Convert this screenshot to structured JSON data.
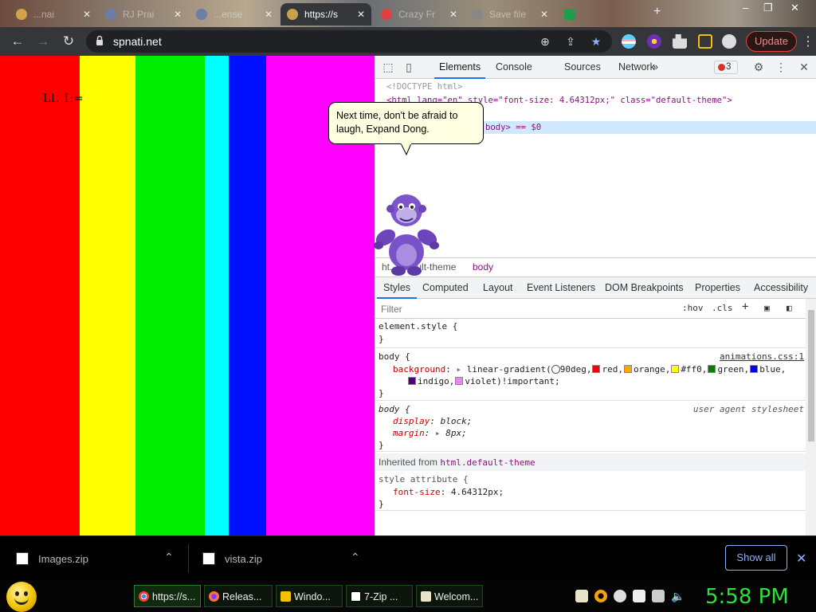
{
  "tabs": [
    {
      "title": "...nai"
    },
    {
      "title": "RJ Prai"
    },
    {
      "title": "...ense"
    },
    {
      "title": "https://s"
    },
    {
      "title": "Crazy Fr"
    },
    {
      "title": "Save file"
    }
  ],
  "new_tab_label": "+",
  "toolbar": {
    "url": "spnati.net",
    "update_label": "Update"
  },
  "page": {
    "body_text": "Ll. I:=",
    "stripe_colors": [
      "#ff0000",
      "#ffff00",
      "#00ee00",
      "#00ffff",
      "#0010ff",
      "#ff00ff"
    ]
  },
  "bonzi": {
    "speech": "Next time, don't be afraid to laugh, Expand Dong."
  },
  "devtools": {
    "tabs": [
      "Elements",
      "Console",
      "Sources",
      "Network"
    ],
    "more": "»",
    "error_count": "3",
    "dom": {
      "doctype": "<!DOCTYPE html>",
      "html_line": "<html lang=\"en\" style=\"font-size: 4.64312px;\" class=\"default-theme\">",
      "selected_line": "body> == $0"
    },
    "breadcrumbs": [
      "ht...default-theme",
      "body"
    ],
    "subtabs": [
      "Styles",
      "Computed",
      "Layout",
      "Event Listeners",
      "DOM Breakpoints",
      "Properties",
      "Accessibility"
    ],
    "filter_placeholder": "Filter",
    "hov": ":hov",
    "cls": ".cls",
    "rules": {
      "element_style": "element.style {",
      "close": "}",
      "body_selector": "body {",
      "body_source": "animations.css:1",
      "background_prop": "background",
      "gradient_prefix": "linear-gradient(",
      "gradient_angle": "90deg,",
      "gradient_colors": [
        {
          "name": "red,",
          "swatch": "#ff0000"
        },
        {
          "name": "orange,",
          "swatch": "#ffa500"
        },
        {
          "name": "#ff0,",
          "swatch": "#ffff00"
        },
        {
          "name": "green,",
          "swatch": "#008000"
        },
        {
          "name": "blue,",
          "swatch": "#0000ff"
        }
      ],
      "gradient_colors_2": [
        {
          "name": "indigo,",
          "swatch": "#4b0082"
        },
        {
          "name": "violet)!important;",
          "swatch": "#ee82ee"
        }
      ],
      "ua_selector": "body {",
      "ua_source": "user agent stylesheet",
      "display_prop": "display",
      "display_val": "block;",
      "margin_prop": "margin",
      "margin_val": "8px;",
      "inherited_label": "Inherited from",
      "inherited_from": "html.default-theme",
      "style_attr": "style attribute {",
      "font_size_prop": "font-size",
      "font_size_val": "4.64312px;"
    }
  },
  "downloads": {
    "items": [
      {
        "name": "Images.zip"
      },
      {
        "name": "vista.zip"
      }
    ],
    "show_all": "Show all"
  },
  "taskbar": {
    "items": [
      {
        "label": "https://s..."
      },
      {
        "label": "Releas..."
      },
      {
        "label": "Windo..."
      },
      {
        "label": "7-Zip ..."
      },
      {
        "label": "Welcom..."
      }
    ],
    "clock": "5:58 PM"
  }
}
